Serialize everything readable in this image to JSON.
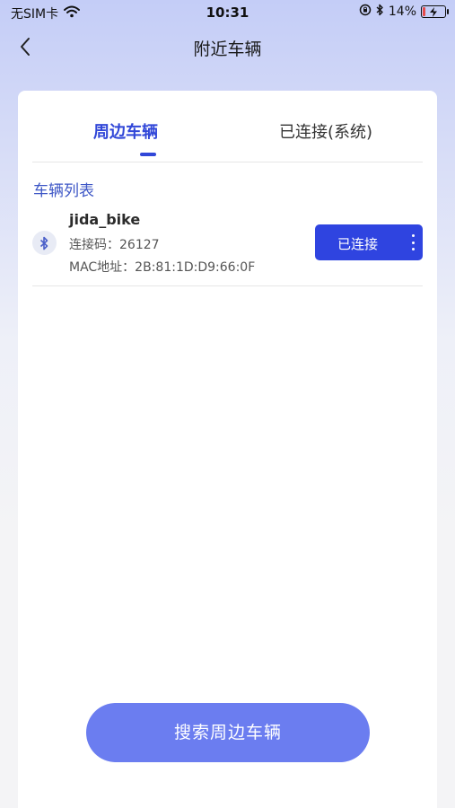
{
  "status_bar": {
    "carrier": "无SIM卡",
    "time": "10:31",
    "battery_percent": "14%",
    "battery_level": 0.14,
    "icons": [
      "wifi-icon",
      "rotation-lock-icon",
      "bluetooth-icon",
      "battery-icon"
    ]
  },
  "nav": {
    "title": "附近车辆",
    "back_icon": "chevron-left-icon"
  },
  "tabs": [
    {
      "label": "周边车辆",
      "active": true
    },
    {
      "label": "已连接(系统)",
      "active": false
    }
  ],
  "section": {
    "title": "车辆列表"
  },
  "devices": [
    {
      "name": "jida_bike",
      "code_line": "连接码：26127",
      "mac_line": "MAC地址：2B:81:1D:D9:66:0F",
      "button_label": "已连接",
      "icon": "bluetooth-icon"
    }
  ],
  "search_button": {
    "label": "搜索周边车辆"
  },
  "colors": {
    "accent": "#2f44e0",
    "tab_active": "#3147d8",
    "search_button": "#6b7df0",
    "battery_low": "#e54b4b"
  }
}
